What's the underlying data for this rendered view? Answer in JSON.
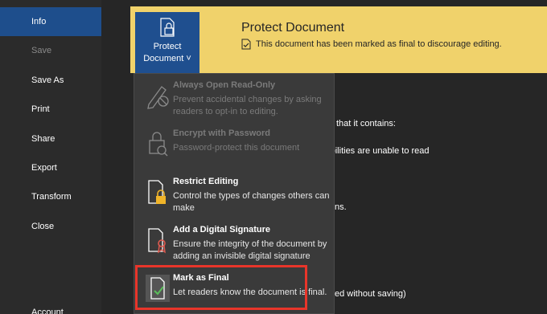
{
  "sidebar": {
    "items": [
      {
        "label": "Info",
        "state": "active"
      },
      {
        "label": "Save",
        "state": "disabled"
      },
      {
        "label": "Save As",
        "state": "normal"
      },
      {
        "label": "Print",
        "state": "normal"
      },
      {
        "label": "Share",
        "state": "normal"
      },
      {
        "label": "Export",
        "state": "normal"
      },
      {
        "label": "Transform",
        "state": "normal"
      },
      {
        "label": "Close",
        "state": "normal"
      },
      {
        "label": "Account",
        "state": "normal"
      }
    ]
  },
  "protect": {
    "button_line1": "Protect",
    "button_line2": "Document ˅",
    "title": "Protect Document",
    "message": "This document has been marked as final to discourage editing."
  },
  "background_text": {
    "frag1": "are that it contains:",
    "frag2": "sabilities are unable to read",
    "frag3": "ns.",
    "frag4": "ed without saving)"
  },
  "menu": {
    "items": [
      {
        "title": "Always Open Read-Only",
        "desc": "Prevent accidental changes by asking readers to opt-in to editing.",
        "state": "disabled",
        "icon": "pen-icon"
      },
      {
        "title": "Encrypt with Password",
        "desc": "Password-protect this document",
        "state": "disabled",
        "icon": "lock-key-icon"
      },
      {
        "title": "Restrict Editing",
        "desc": "Control the types of changes others can make",
        "state": "normal",
        "icon": "document-lock-icon"
      },
      {
        "title": "Add a Digital Signature",
        "desc": "Ensure the integrity of the document by adding an invisible digital signature",
        "state": "normal",
        "icon": "signature-ribbon-icon"
      },
      {
        "title": "Mark as Final",
        "desc": "Let readers know the document is final.",
        "state": "normal",
        "icon": "document-check-icon"
      }
    ]
  },
  "colors": {
    "banner": "#f0d26b",
    "accent": "#1f4f8f",
    "highlight": "#e8352a"
  }
}
